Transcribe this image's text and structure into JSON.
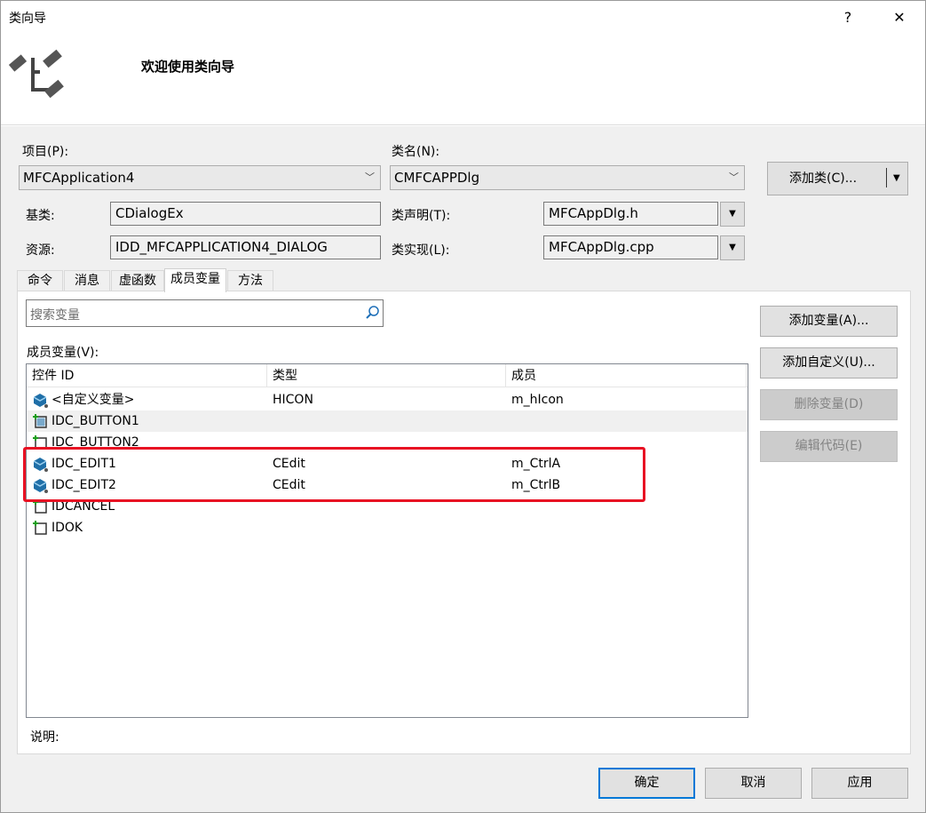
{
  "window": {
    "title": "类向导",
    "help": "?",
    "close": "✕"
  },
  "header": {
    "welcome": "欢迎使用类向导"
  },
  "project": {
    "label": "项目(P):",
    "value": "MFCApplication4"
  },
  "classname": {
    "label": "类名(N):",
    "value": "CMFCAPPDlg"
  },
  "add_class_button": "添加类(C)...",
  "base_class": {
    "label": "基类:",
    "value": "CDialogEx"
  },
  "resource": {
    "label": "资源:",
    "value": "IDD_MFCAPPLICATION4_DIALOG"
  },
  "class_decl": {
    "label": "类声明(T):",
    "value": "MFCAppDlg.h"
  },
  "class_impl": {
    "label": "类实现(L):",
    "value": "MFCAppDlg.cpp"
  },
  "tabs": [
    {
      "label": "命令"
    },
    {
      "label": "消息"
    },
    {
      "label": "虚函数"
    },
    {
      "label": "成员变量"
    },
    {
      "label": "方法"
    }
  ],
  "search": {
    "placeholder": "搜索变量"
  },
  "members_label": "成员变量(V):",
  "columns": [
    "控件 ID",
    "类型",
    "成员"
  ],
  "rows": [
    {
      "id": "<自定义变量>",
      "type": "HICON",
      "member": "m_hIcon",
      "icon": "variable-icon"
    },
    {
      "id": "IDC_BUTTON1",
      "type": "",
      "member": "",
      "icon": "control-icon"
    },
    {
      "id": "IDC_BUTTON2",
      "type": "",
      "member": "",
      "icon": "control-icon"
    },
    {
      "id": "IDC_EDIT1",
      "type": "CEdit",
      "member": "m_CtrlA",
      "icon": "variable-icon"
    },
    {
      "id": "IDC_EDIT2",
      "type": "CEdit",
      "member": "m_CtrlB",
      "icon": "variable-icon"
    },
    {
      "id": "IDCANCEL",
      "type": "",
      "member": "",
      "icon": "control-icon"
    },
    {
      "id": "IDOK",
      "type": "",
      "member": "",
      "icon": "control-icon"
    }
  ],
  "side_buttons": {
    "add_variable": "添加变量(A)...",
    "add_custom": "添加自定义(U)...",
    "delete_variable": "删除变量(D)",
    "edit_code": "编辑代码(E)"
  },
  "description_label": "说明:",
  "footer": {
    "ok": "确定",
    "cancel": "取消",
    "apply": "应用"
  },
  "colors": {
    "highlight": "#e81123",
    "focus": "#0078d7"
  }
}
